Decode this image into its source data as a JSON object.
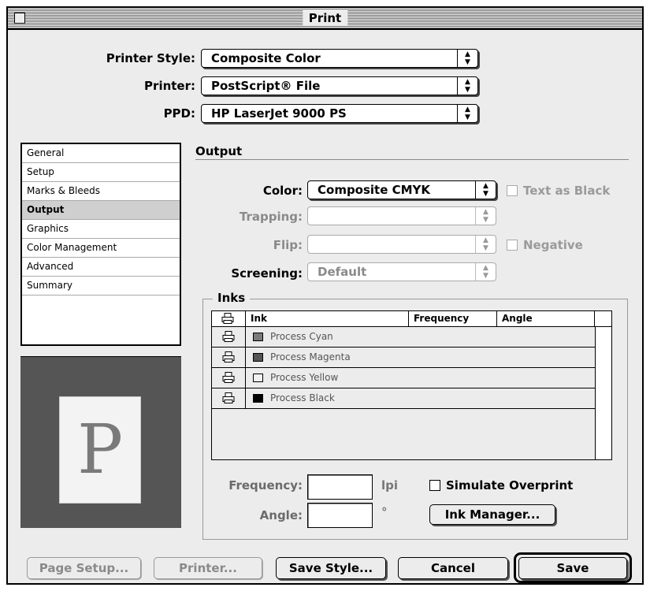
{
  "window": {
    "title": "Print"
  },
  "printer_style": {
    "label": "Printer Style:",
    "value": "Composite Color"
  },
  "printer": {
    "label": "Printer:",
    "value": "PostScript® File"
  },
  "ppd": {
    "label": "PPD:",
    "value": "HP LaserJet 9000 PS"
  },
  "icons": {
    "popup_arrows": "up-down-arrows-icon",
    "printer": "printer-icon"
  },
  "sidebar": {
    "items": [
      {
        "label": "General"
      },
      {
        "label": "Setup"
      },
      {
        "label": "Marks & Bleeds"
      },
      {
        "label": "Output",
        "selected": true
      },
      {
        "label": "Graphics"
      },
      {
        "label": "Color Management"
      },
      {
        "label": "Advanced"
      },
      {
        "label": "Summary"
      }
    ]
  },
  "preview": {
    "letter": "P"
  },
  "output": {
    "heading": "Output",
    "color": {
      "label": "Color:",
      "value": "Composite CMYK"
    },
    "text_as_black": {
      "label": "Text as Black",
      "checked": false,
      "enabled": false
    },
    "trapping": {
      "label": "Trapping:",
      "value": "",
      "enabled": false
    },
    "flip": {
      "label": "Flip:",
      "value": "",
      "enabled": false
    },
    "negative": {
      "label": "Negative",
      "checked": false,
      "enabled": false
    },
    "screening": {
      "label": "Screening:",
      "value": "Default",
      "enabled": false
    }
  },
  "inks": {
    "label": "Inks",
    "columns": {
      "ink": "Ink",
      "frequency": "Frequency",
      "angle": "Angle"
    },
    "rows": [
      {
        "name": "Process Cyan",
        "swatch": "#7a7a7a"
      },
      {
        "name": "Process Magenta",
        "swatch": "#555555"
      },
      {
        "name": "Process Yellow",
        "swatch": "#f0f0f0"
      },
      {
        "name": "Process Black",
        "swatch": "#000000"
      }
    ],
    "frequency": {
      "label": "Frequency:",
      "value": "",
      "unit": "lpi"
    },
    "angle": {
      "label": "Angle:",
      "value": "",
      "unit": "°"
    },
    "simulate_overprint": {
      "label": "Simulate Overprint",
      "checked": false
    },
    "ink_manager_label": "Ink Manager..."
  },
  "buttons": {
    "page_setup": "Page Setup...",
    "printer": "Printer...",
    "save_style": "Save Style...",
    "cancel": "Cancel",
    "save": "Save"
  }
}
